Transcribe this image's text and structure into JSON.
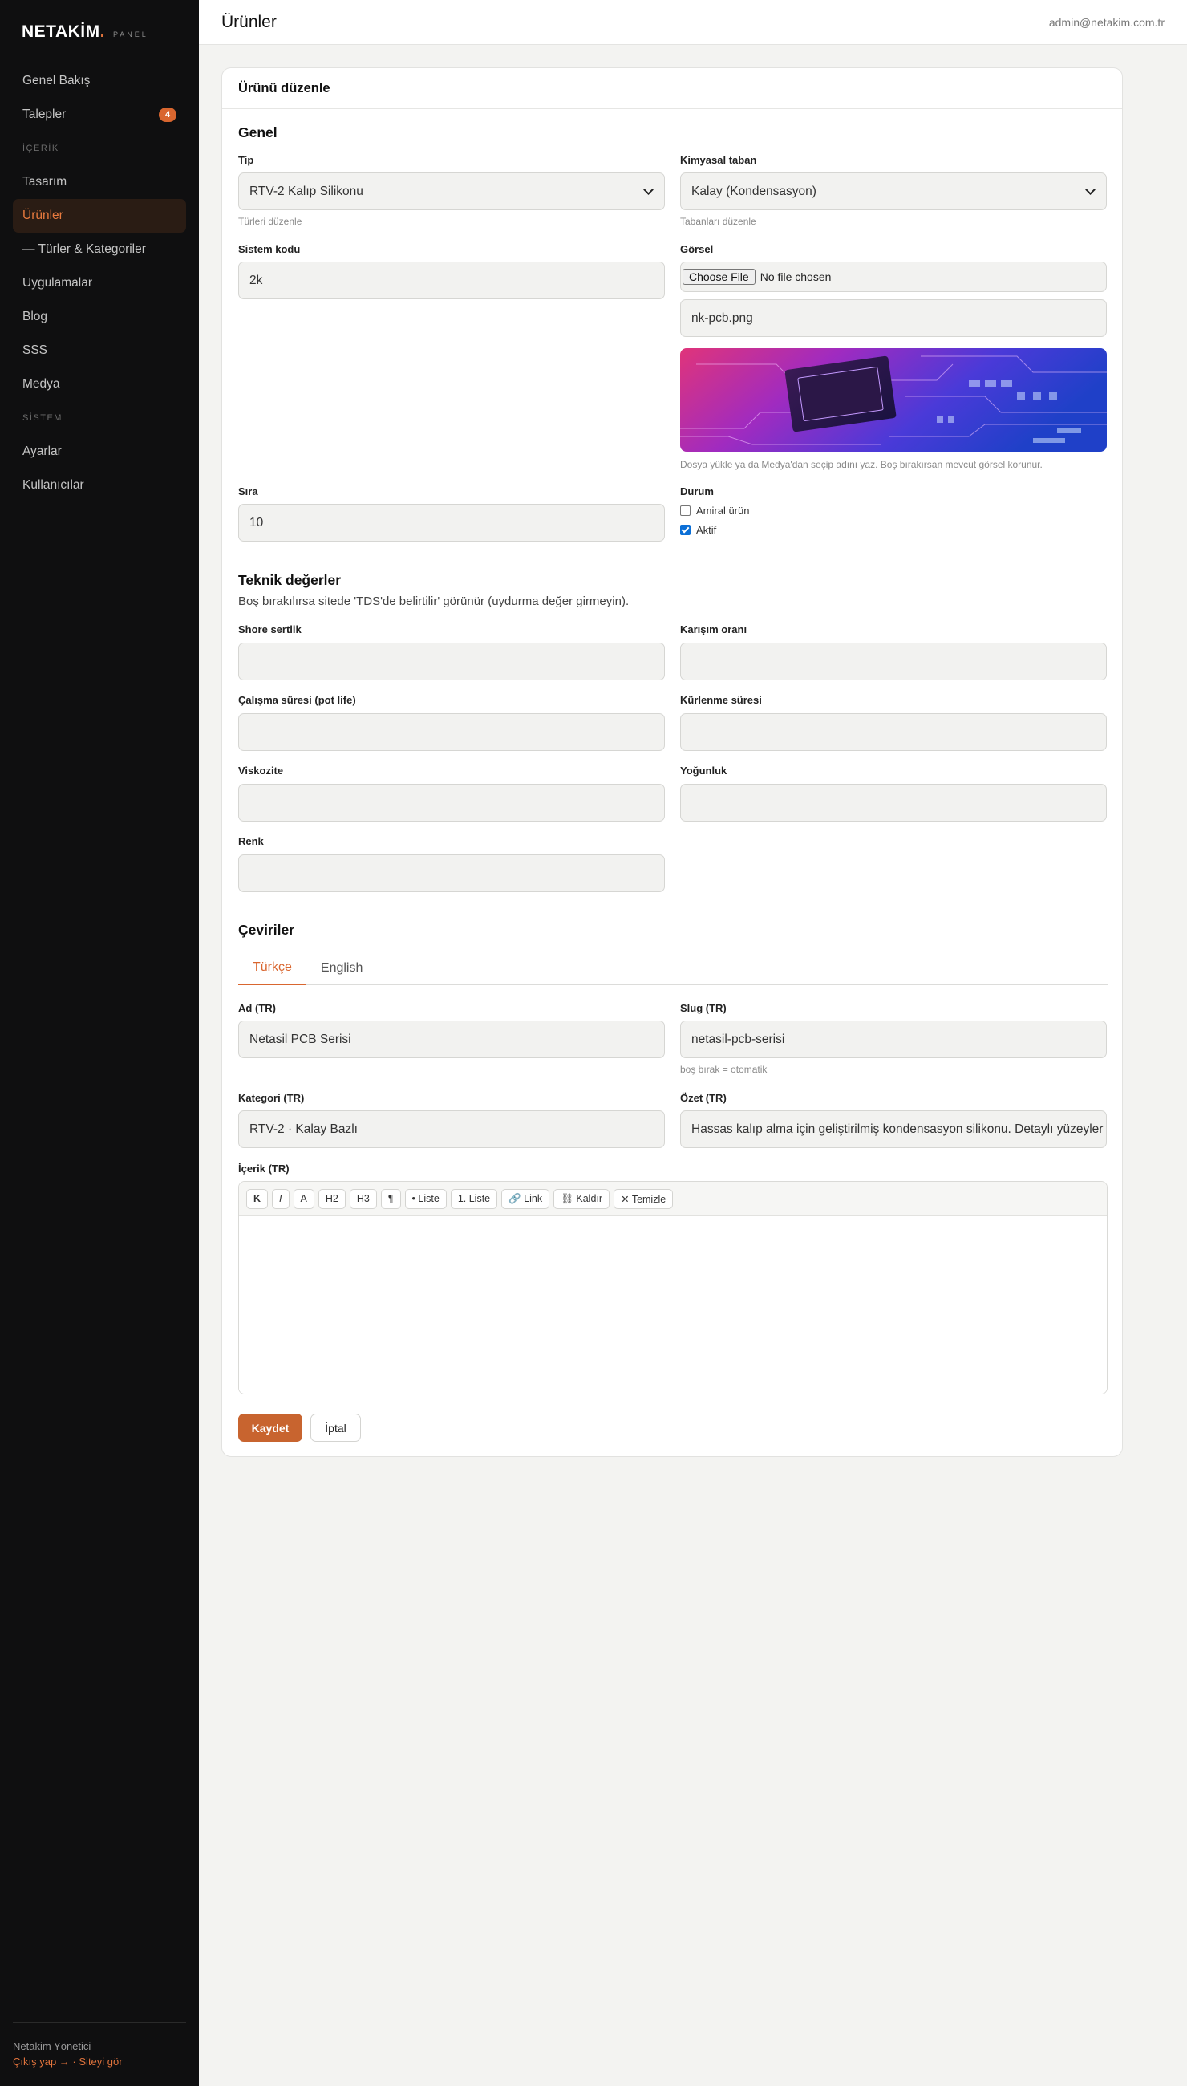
{
  "brand": {
    "logo": "NETAKİM",
    "logo_dot": ".",
    "sub": "PANEL"
  },
  "sidebar": {
    "items": [
      {
        "label": "Genel Bakış"
      },
      {
        "label": "Talepler",
        "badge": "4"
      },
      {
        "section": "İÇERİK"
      },
      {
        "label": "Tasarım"
      },
      {
        "label": "Ürünler",
        "active": true
      },
      {
        "label": "— Türler & Kategoriler"
      },
      {
        "label": "Uygulamalar"
      },
      {
        "label": "Blog"
      },
      {
        "label": "SSS"
      },
      {
        "label": "Medya"
      },
      {
        "section": "SİSTEM"
      },
      {
        "label": "Ayarlar"
      },
      {
        "label": "Kullanıcılar"
      }
    ],
    "footer_user": "Netakim Yönetici",
    "logout": "Çıkış yap →",
    "separator": "·",
    "view_site": "Siteyi gör"
  },
  "header": {
    "title": "Ürünler",
    "user_email": "admin@netakim.com.tr"
  },
  "form": {
    "card_title": "Ürünü düzenle",
    "general": {
      "title": "Genel",
      "type_label": "Tip",
      "type_value": "RTV-2 Kalıp Silikonu",
      "type_help": "Türleri düzenle",
      "base_label": "Kimyasal taban",
      "base_value": "Kalay (Kondensasyon)",
      "base_help": "Tabanları düzenle",
      "code_label": "Sistem kodu",
      "code_value": "2k",
      "image_label": "Görsel",
      "file_button": "Choose File",
      "file_status": "No file chosen",
      "image_name": "nk-pcb.png",
      "image_help": "Dosya yükle ya da Medya'dan seçip adını yaz. Boş bırakırsan mevcut görsel korunur.",
      "order_label": "Sıra",
      "order_value": "10",
      "status_label": "Durum",
      "flagship_label": "Amiral ürün",
      "flagship_checked": false,
      "active_label": "Aktif",
      "active_checked": true
    },
    "technical": {
      "title": "Teknik değerler",
      "note": "Boş bırakılırsa sitede 'TDS'de belirtilir' görünür (uydurma değer girmeyin).",
      "shore_label": "Shore sertlik",
      "mix_label": "Karışım oranı",
      "potlife_label": "Çalışma süresi (pot life)",
      "cure_label": "Kürlenme süresi",
      "viscosity_label": "Viskozite",
      "density_label": "Yoğunluk",
      "color_label": "Renk"
    },
    "translations": {
      "title": "Çeviriler",
      "tabs": [
        "Türkçe",
        "English"
      ],
      "name_label": "Ad (TR)",
      "name_value": "Netasil PCB Serisi",
      "slug_label": "Slug (TR)",
      "slug_value": "netasil-pcb-serisi",
      "slug_help": "boş bırak = otomatik",
      "category_label": "Kategori (TR)",
      "category_value": "RTV-2 · Kalay Bazlı",
      "summary_label": "Özet (TR)",
      "summary_value": "Hassas kalıp alma için geliştirilmiş kondensasyon silikonu. Detaylı yüzeyler",
      "content_label": "İçerik (TR)"
    },
    "toolbar": [
      "K",
      "I",
      "A",
      "H2",
      "H3",
      "¶",
      "• Liste",
      "1. Liste",
      "🔗 Link",
      "⛓ Kaldır",
      "✕ Temizle"
    ],
    "save": "Kaydet",
    "cancel": "İptal"
  },
  "colors": {
    "accent": "#d9662f",
    "sidebar_bg": "#0f0f10"
  }
}
